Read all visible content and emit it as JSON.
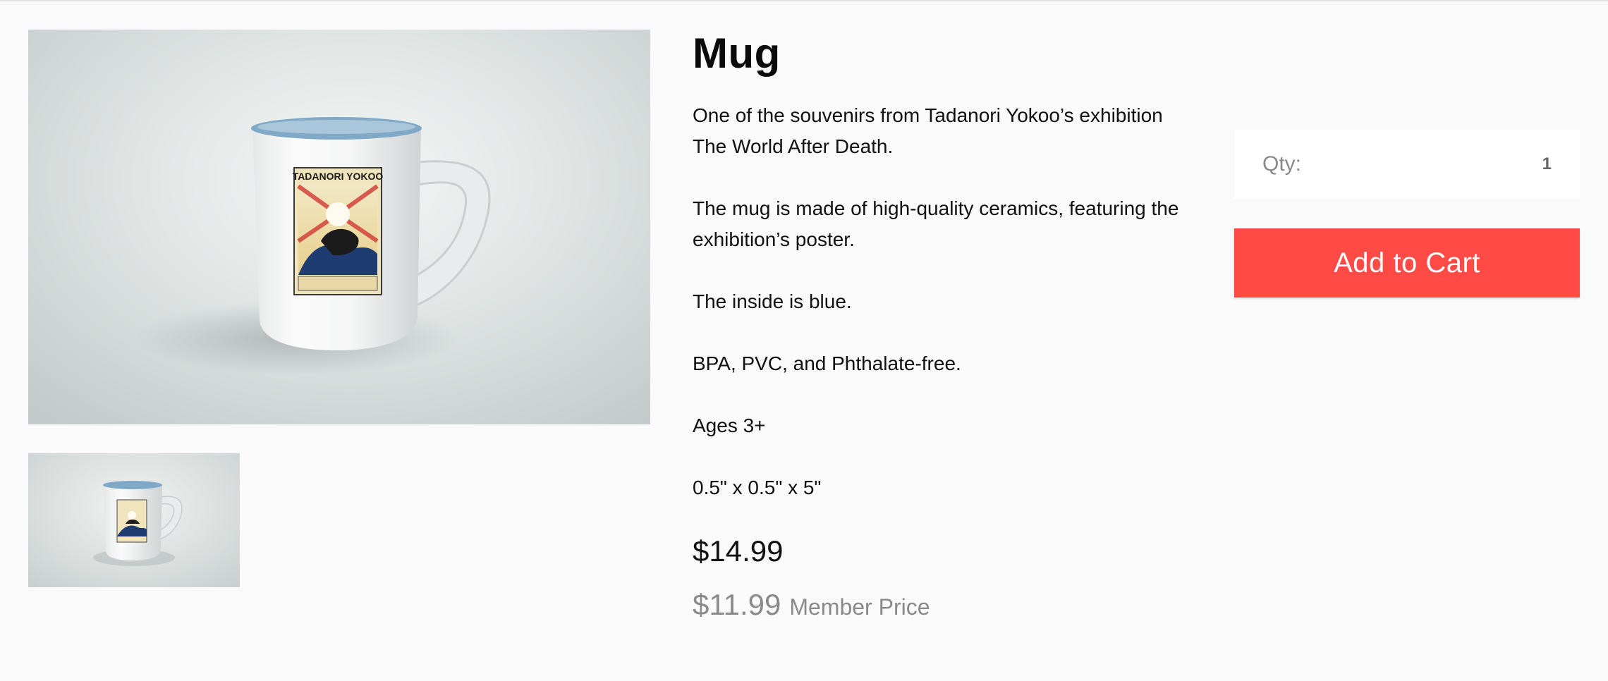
{
  "product": {
    "title": "Mug",
    "description": [
      "One of the souvenirs from Tadanori Yokoo’s exhibition The World After Death.",
      "The mug is made of high-quality ceramics, featuring the exhibition’s poster.",
      "The inside is blue.",
      "BPA, PVC, and Phthalate-free.",
      "Ages 3+",
      "0.5\" x 0.5\" x 5\""
    ],
    "price": "$14.99",
    "member_price": "$11.99",
    "member_price_label": "Member Price",
    "poster_text": "TADANORI YOKOO"
  },
  "purchase": {
    "qty_label": "Qty:",
    "qty_value": "1",
    "add_to_cart_label": "Add to Cart"
  },
  "colors": {
    "accent": "#ff4a45",
    "background": "#fafafa",
    "muted_text": "#8a8a8a",
    "mug_rim": "#7fa9c6"
  },
  "gallery": {
    "images": [
      {
        "kind": "main-image",
        "subject": "mug-photo",
        "selected": true
      },
      {
        "kind": "thumbnail",
        "subject": "mug-photo",
        "selected": true
      }
    ]
  }
}
